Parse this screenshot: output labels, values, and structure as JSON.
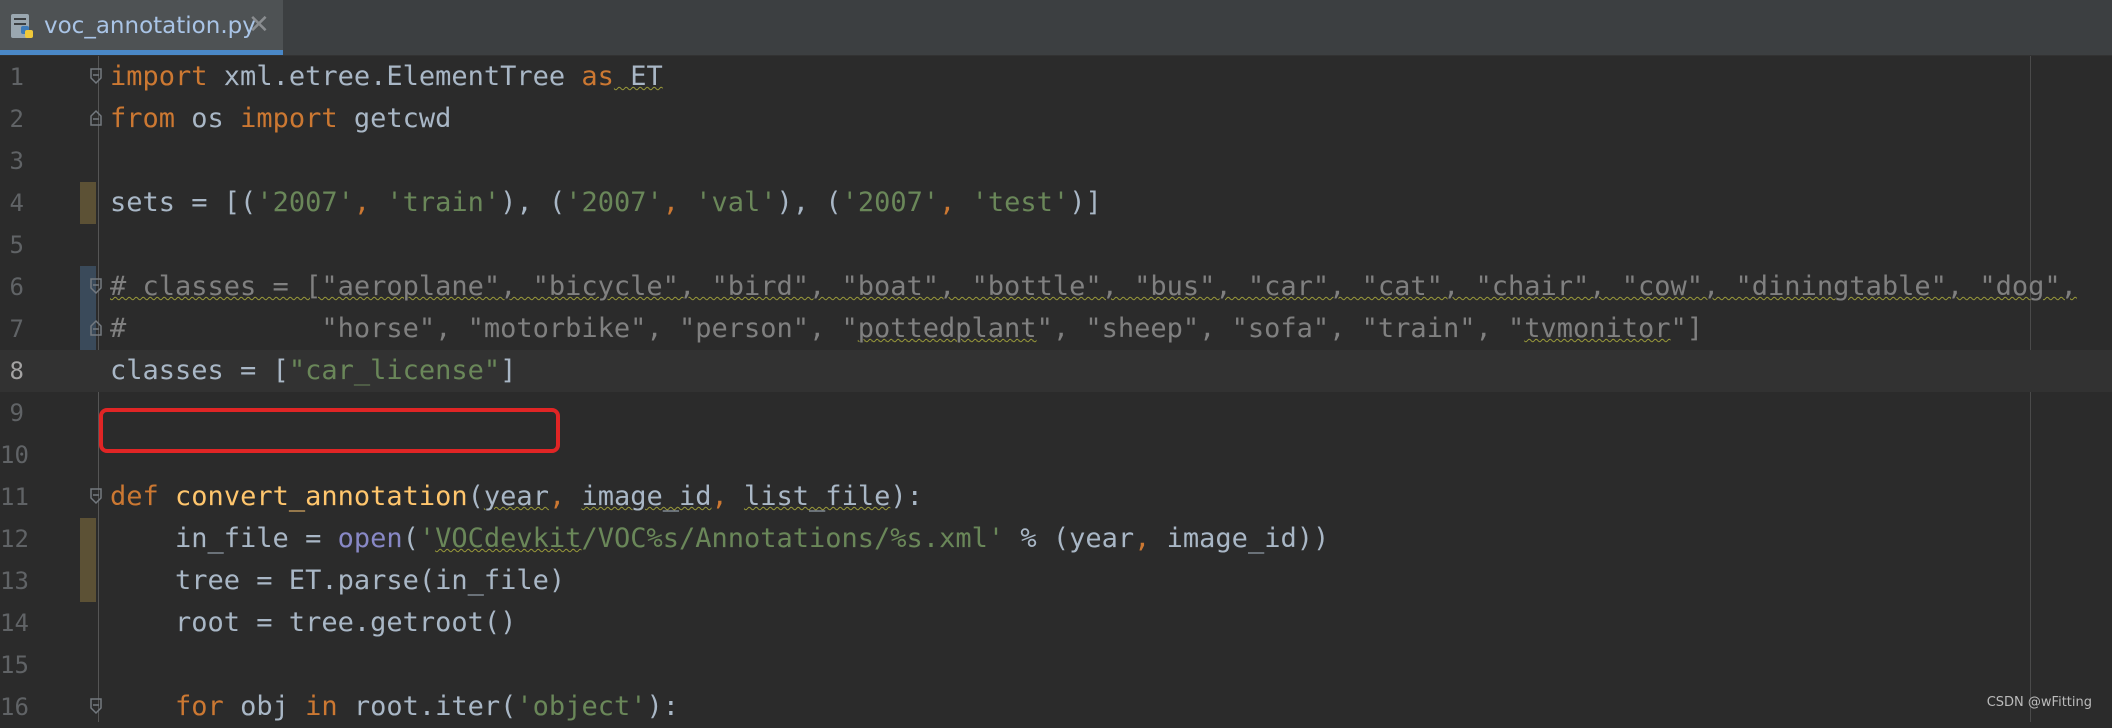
{
  "tab": {
    "filename": "voc_annotation.py",
    "close_glyph": "✕",
    "icon": "python-file-icon"
  },
  "colors": {
    "background": "#2b2b2b",
    "keyword": "#cc7832",
    "string": "#6a8759",
    "function": "#ffc66d",
    "builtin": "#8888c6",
    "comment": "#808080",
    "highlight_box": "#e02525"
  },
  "lines": [
    {
      "num": "1"
    },
    {
      "num": "2"
    },
    {
      "num": "3"
    },
    {
      "num": "4"
    },
    {
      "num": "5"
    },
    {
      "num": "6"
    },
    {
      "num": "7"
    },
    {
      "num": "8"
    },
    {
      "num": "9"
    },
    {
      "num": "10"
    },
    {
      "num": "11"
    },
    {
      "num": "12"
    },
    {
      "num": "13"
    },
    {
      "num": "14"
    },
    {
      "num": "15"
    },
    {
      "num": "16"
    }
  ],
  "code": {
    "l1": {
      "kw1": "import",
      "mod": " xml.etree.ElementTree ",
      "kw2": "as",
      "alias": " ET"
    },
    "l2": {
      "kw1": "from",
      "mod": " os ",
      "kw2": "import",
      "name": " getcwd"
    },
    "l4": {
      "a": "sets = [(",
      "s1": "'2007'",
      "c1": ", ",
      "s2": "'train'",
      "b": "), (",
      "s3": "'2007'",
      "c2": ", ",
      "s4": "'val'",
      "d": "), (",
      "s5": "'2007'",
      "c3": ", ",
      "s6": "'test'",
      "e": ")]"
    },
    "l6": "# classes = [\"aeroplane\", \"bicycle\", \"bird\", \"boat\", \"bottle\", \"bus\", \"car\", \"cat\", \"chair\", \"cow\", \"diningtable\", \"dog\",",
    "l7_prefix": "#            \"horse\", \"motorbike\", \"person\", \"",
    "l7_wavy1": "pottedplant",
    "l7_mid": "\", \"sheep\", \"sofa\", \"train\", \"",
    "l7_wavy2": "tvmonitor",
    "l7_suffix": "\"]",
    "l8": {
      "a": "classes = [",
      "s": "\"car_license\"",
      "b": "]"
    },
    "l11": {
      "kw": "def",
      "sp": " ",
      "fn": "convert_annotation",
      "open": "(",
      "p1": "year",
      "c1": ", ",
      "p2": "image_id",
      "c2": ", ",
      "p3": "list_file",
      "close": "):"
    },
    "l12": {
      "a": "    in_file = ",
      "bi": "open",
      "b": "(",
      "s1": "'",
      "s_wavy": "VOCdevkit",
      "s2": "/VOC%s/Annotations/%s.xml'",
      "c": " % (year",
      "comma": ",",
      "d": " image_id))"
    },
    "l13": "    tree = ET.parse(in_file)",
    "l14": "    root = tree.getroot()",
    "l16": {
      "indent": "    ",
      "kw1": "for",
      "mid": " obj ",
      "kw2": "in",
      "b": " root.iter(",
      "s": "'object'",
      "c": "):"
    }
  },
  "watermark": "CSDN @wFitting"
}
